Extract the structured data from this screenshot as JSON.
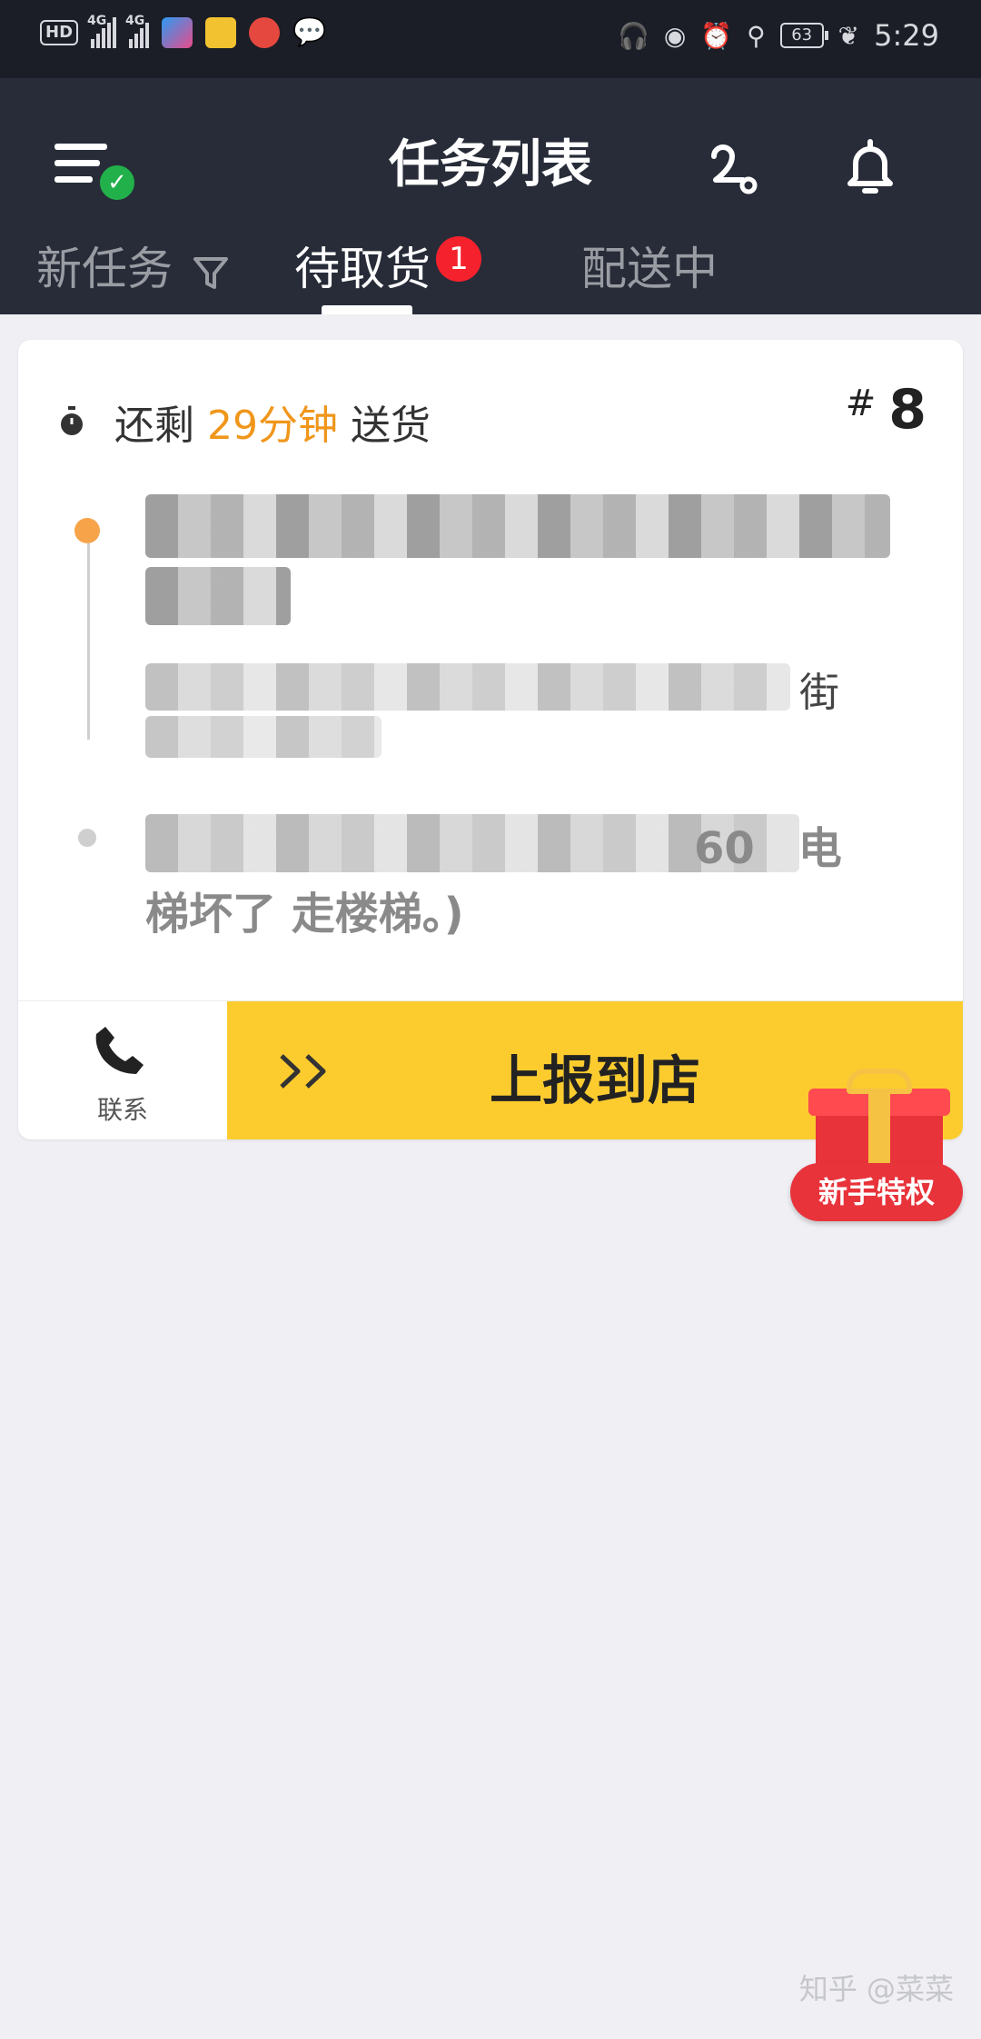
{
  "status_bar": {
    "hd": "HD",
    "network1": "4G",
    "network2": "4G",
    "battery": "63",
    "time": "5:29"
  },
  "header": {
    "title": "任务列表",
    "tabs": [
      {
        "label": "新任务"
      },
      {
        "label": "待取货",
        "badge": "1"
      },
      {
        "label": "配送中"
      }
    ]
  },
  "task": {
    "time_prefix": "还剩",
    "time_remaining": "29分钟",
    "time_suffix": "送货",
    "order_hash": "#",
    "order_number": "8",
    "store_address_tail": "街",
    "dest_fragment": "60",
    "dest_fragment_2": "电",
    "dest_note": "梯坏了 走楼梯。)",
    "contact_label": "联系",
    "report_label": "上报到店"
  },
  "promo": {
    "label": "新手特权"
  },
  "watermark": "知乎 @菜菜",
  "colors": {
    "header_bg": "#272c38",
    "accent_yellow": "#fccc2f",
    "highlight_orange": "#f0961b",
    "badge_red": "#f5222d"
  }
}
